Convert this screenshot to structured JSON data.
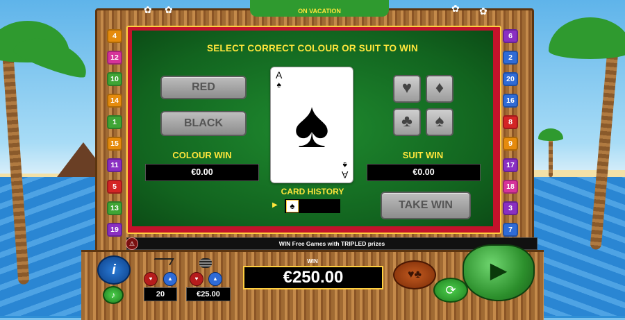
{
  "game": {
    "title": "SELECT CORRECT COLOUR OR SUIT TO WIN",
    "logo_subtitle": "ON VACATION"
  },
  "colour": {
    "red_label": "RED",
    "black_label": "BLACK",
    "win_label": "COLOUR WIN",
    "win_value": "€0.00"
  },
  "suit": {
    "win_label": "SUIT WIN",
    "win_value": "€0.00",
    "buttons": [
      "hearts",
      "diamonds",
      "clubs",
      "spades"
    ],
    "glyphs": [
      "♥",
      "♦",
      "♣",
      "♠"
    ]
  },
  "card": {
    "rank": "A",
    "suit_glyph": "♠"
  },
  "history": {
    "label": "CARD HISTORY",
    "items": [
      "♠"
    ],
    "arrow": "▶"
  },
  "take_win_label": "TAKE WIN",
  "paylines": {
    "left": [
      {
        "n": "4",
        "color": "#e58b0d"
      },
      {
        "n": "12",
        "color": "#d6339a"
      },
      {
        "n": "10",
        "color": "#3fa535"
      },
      {
        "n": "14",
        "color": "#e58b0d"
      },
      {
        "n": "1",
        "color": "#3fa535"
      },
      {
        "n": "15",
        "color": "#e58b0d"
      },
      {
        "n": "11",
        "color": "#8a2fc2"
      },
      {
        "n": "5",
        "color": "#d42525"
      },
      {
        "n": "13",
        "color": "#3fa535"
      },
      {
        "n": "19",
        "color": "#8a2fc2"
      }
    ],
    "right": [
      {
        "n": "6",
        "color": "#8a2fc2"
      },
      {
        "n": "2",
        "color": "#2f6bd6"
      },
      {
        "n": "20",
        "color": "#2f6bd6"
      },
      {
        "n": "16",
        "color": "#2f6bd6"
      },
      {
        "n": "8",
        "color": "#d42525"
      },
      {
        "n": "9",
        "color": "#e58b0d"
      },
      {
        "n": "17",
        "color": "#8a2fc2"
      },
      {
        "n": "18",
        "color": "#d6339a"
      },
      {
        "n": "3",
        "color": "#8a2fc2"
      },
      {
        "n": "7",
        "color": "#2f6bd6"
      }
    ]
  },
  "marquee": "WIN Free Games with TRIPLED prizes",
  "bottom": {
    "lines_value": "20",
    "bet_value": "€25.00",
    "win_label": "WIN",
    "win_value": "€250.00"
  },
  "icons": {
    "play": "▶",
    "info": "i",
    "autoplay": "⟳",
    "sound": "♪",
    "gamble_suits": "♥♣",
    "minus": "▲",
    "plus": "▲"
  }
}
